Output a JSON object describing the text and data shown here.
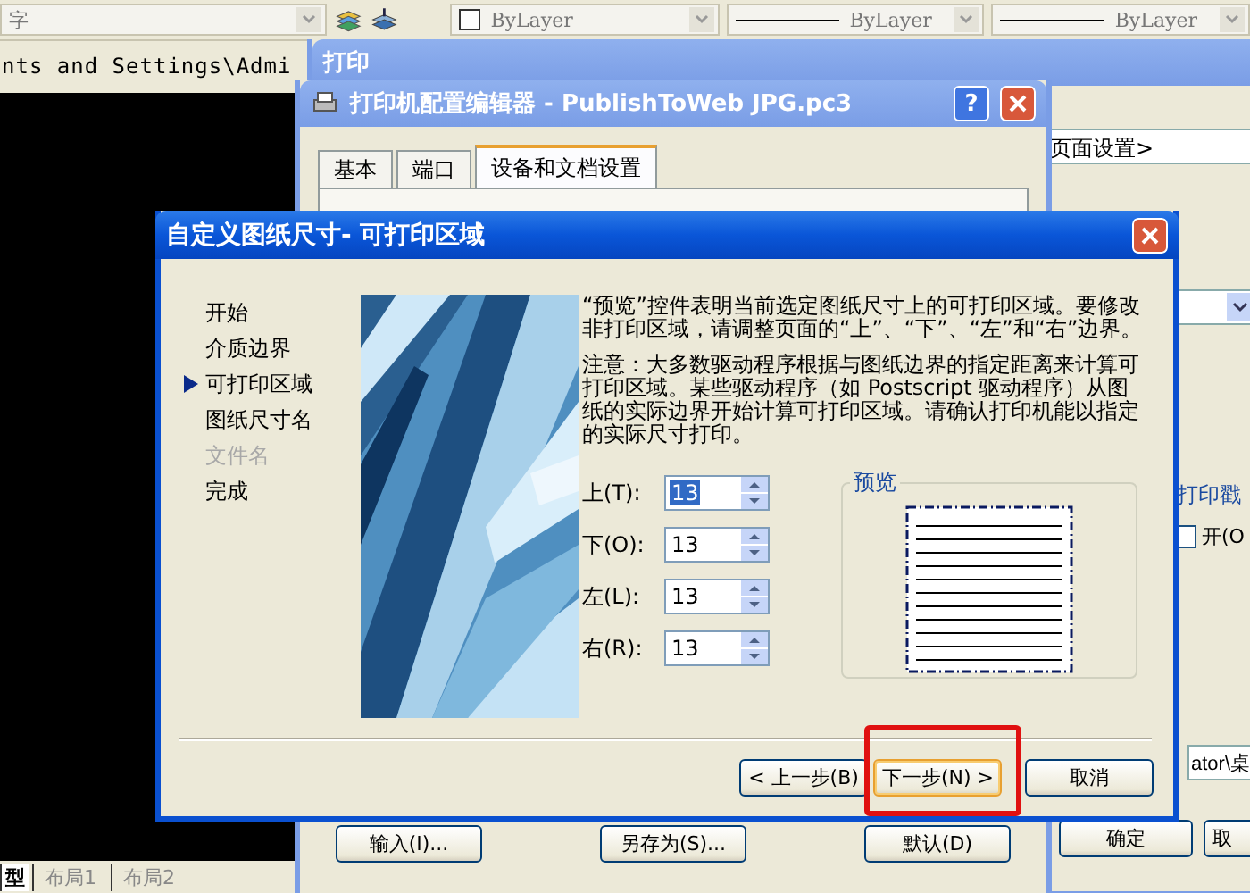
{
  "toolbar": {
    "style_text": "字",
    "combos": [
      {
        "kind": "color",
        "value": "ByLayer"
      },
      {
        "kind": "line",
        "value": "ByLayer"
      },
      {
        "kind": "line",
        "value": "ByLayer"
      }
    ]
  },
  "cad": {
    "path": "nts and Settings\\Admi",
    "layout_tabs": [
      {
        "label": "型",
        "selected": true
      },
      {
        "label": "布局1",
        "selected": false
      },
      {
        "label": "布局2",
        "selected": false
      }
    ]
  },
  "print_window": {
    "title": "打印",
    "page_setup": "页面设置>",
    "stamp_label": "打印戳",
    "stamp_checkbox": {
      "label": "开(O",
      "checked": false
    },
    "path": "ator\\桌",
    "buttons": [
      "确定",
      "取"
    ]
  },
  "config_editor": {
    "title": "打印机配置编辑器 - PublishToWeb JPG.pc3",
    "help_button": "?",
    "tabs": [
      {
        "label": "基本",
        "selected": false
      },
      {
        "label": "端口",
        "selected": false
      },
      {
        "label": "设备和文档设置",
        "selected": true
      }
    ],
    "buttons": [
      "输入(I)...",
      "另存为(S)...",
      "默认(D)"
    ]
  },
  "wizard": {
    "title": "自定义图纸尺寸- 可打印区域",
    "steps": [
      {
        "label": "开始",
        "current": false,
        "disabled": false
      },
      {
        "label": "介质边界",
        "current": false,
        "disabled": false
      },
      {
        "label": "可打印区域",
        "current": true,
        "disabled": false
      },
      {
        "label": "图纸尺寸名",
        "current": false,
        "disabled": false
      },
      {
        "label": "文件名",
        "current": false,
        "disabled": true
      },
      {
        "label": "完成",
        "current": false,
        "disabled": false
      }
    ],
    "description": "“预览”控件表明当前选定图纸尺寸上的可打印区域。要修改非打印区域，请调整页面的“上”、“下”、“左”和“右”边界。",
    "note": "注意：大多数驱动程序根据与图纸边界的指定距离来计算可打印区域。某些驱动程序（如 Postscript 驱动程序）从图纸的实际边界开始计算可打印区域。请确认打印机能以指定的实际尺寸打印。",
    "margins": [
      {
        "label": "上(T):",
        "value": "13",
        "selected": true
      },
      {
        "label": "下(O):",
        "value": "13",
        "selected": false
      },
      {
        "label": "左(L):",
        "value": "13",
        "selected": false
      },
      {
        "label": "右(R):",
        "value": "13",
        "selected": false
      }
    ],
    "preview_label": "预览",
    "buttons": [
      {
        "label": "< 上一步(B)",
        "default": false,
        "highlighted": false
      },
      {
        "label": "下一步(N) >",
        "default": true,
        "highlighted": true
      },
      {
        "label": "取消",
        "default": false,
        "highlighted": false
      }
    ]
  }
}
